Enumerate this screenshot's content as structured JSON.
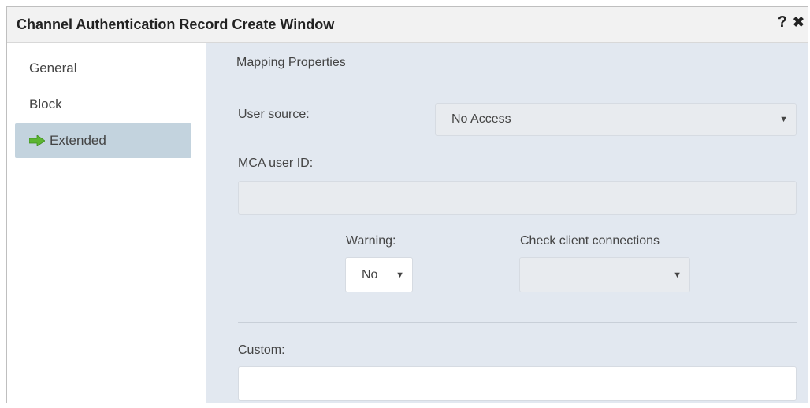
{
  "window": {
    "title": "Channel Authentication Record Create Window",
    "help_label": "?",
    "close_label": "✖"
  },
  "sidebar": {
    "items": [
      {
        "label": "General"
      },
      {
        "label": "Block"
      },
      {
        "label": "Extended",
        "active": true
      }
    ]
  },
  "main": {
    "section_title": "Mapping Properties",
    "user_source": {
      "label": "User source:",
      "value": "No Access"
    },
    "mca_user_id": {
      "label": "MCA user ID:",
      "value": ""
    },
    "warning": {
      "label": "Warning:",
      "value": "No"
    },
    "check_client_connections": {
      "label": "Check client connections",
      "value": ""
    },
    "custom": {
      "label": "Custom:",
      "value": ""
    }
  },
  "colors": {
    "sidebar_active": "#c3d3de",
    "content_bg": "#e2e8f0",
    "arrow_icon": "#5cb531"
  },
  "icons": {
    "active_nav": "green-arrow-right-icon",
    "dropdown": "caret-down-icon",
    "help": "question-mark-icon",
    "close": "close-icon"
  }
}
